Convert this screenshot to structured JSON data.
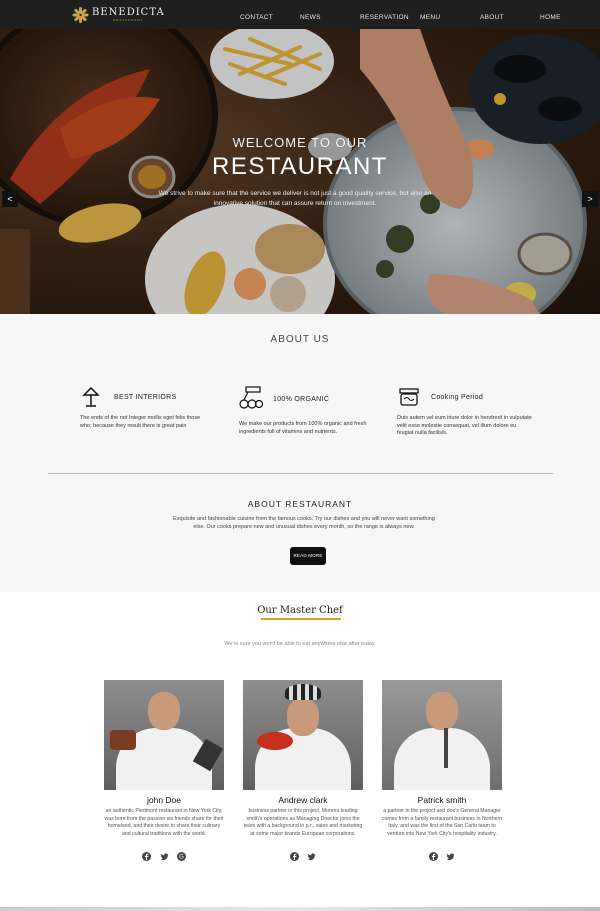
{
  "nav": {
    "logo_name": "BENEDICTA",
    "logo_sub": "RESTAURANT",
    "items": [
      {
        "label": "CONTACT"
      },
      {
        "label": "NEWS"
      },
      {
        "label": "RESERVATION"
      },
      {
        "label": "MENU"
      },
      {
        "label": "ABOUT"
      },
      {
        "label": "HOME"
      }
    ]
  },
  "hero": {
    "title_small": "WELCOME TO OUR",
    "title": "RESTAURANT",
    "text": "We strive to make sure that the service we deliver is not just a good quality service, but also an innovative solution that can assure return on investment.",
    "prev": "<",
    "next": ">"
  },
  "about": {
    "title": "ABOUT US",
    "features": [
      {
        "icon": "lamp-icon",
        "title": "BEST INTERIORS",
        "text": "The ends of the not Integer mollis eget felis those who; because they result there is great pain"
      },
      {
        "icon": "organic-icon",
        "title": "100% ORGANIC",
        "text": "We make our products from 100% organic and fresh ingredients full of vitamins and nutrients."
      },
      {
        "icon": "cooking-pot-icon",
        "title": "Cooking Period",
        "text": "Duis autem vel eum iriure dolor in hendrerit in vulputate velit esse molestie consequat, vel illum dolore eu feugiat nulla facilisis."
      }
    ],
    "restaurant_title": "ABOUT RESTAURANT",
    "restaurant_text": "Exquisite and fashionable cuisine from the famous cooks. Try our dishes and you will never want something else. Our cooks prepare new and unusual dishes every month, so the range is always new.",
    "read_more": "READ MORE"
  },
  "chefs": {
    "title": "Our Master Chef",
    "subtitle": "We're sure you won't be able to eat anywhere else after today.",
    "accent": "#d8a42b",
    "items": [
      {
        "name": "john Doe",
        "desc": "an authentic Piedmont restaurant in New York City, was born from the passion six friends share for their homeland, and their desire to share their culinary and cultural traditions with the world.",
        "socials": [
          "facebook-icon",
          "twitter-icon",
          "google-icon"
        ]
      },
      {
        "name": "Andrew clark",
        "desc": "business partner in this project, Moreno leading smith's operations as Managing Director joins the team with a background in p.r., sales and marketing at some major brands European corporations.",
        "socials": [
          "facebook-icon",
          "twitter-icon"
        ]
      },
      {
        "name": "Patrick smith",
        "desc": "a partner in the project and doe's General Manager comes from a family restaurant business in Northern Italy, and was the first of the San Carlo team to venture into New York City's hospitality industry.",
        "socials": [
          "facebook-icon",
          "twitter-icon"
        ]
      }
    ]
  }
}
